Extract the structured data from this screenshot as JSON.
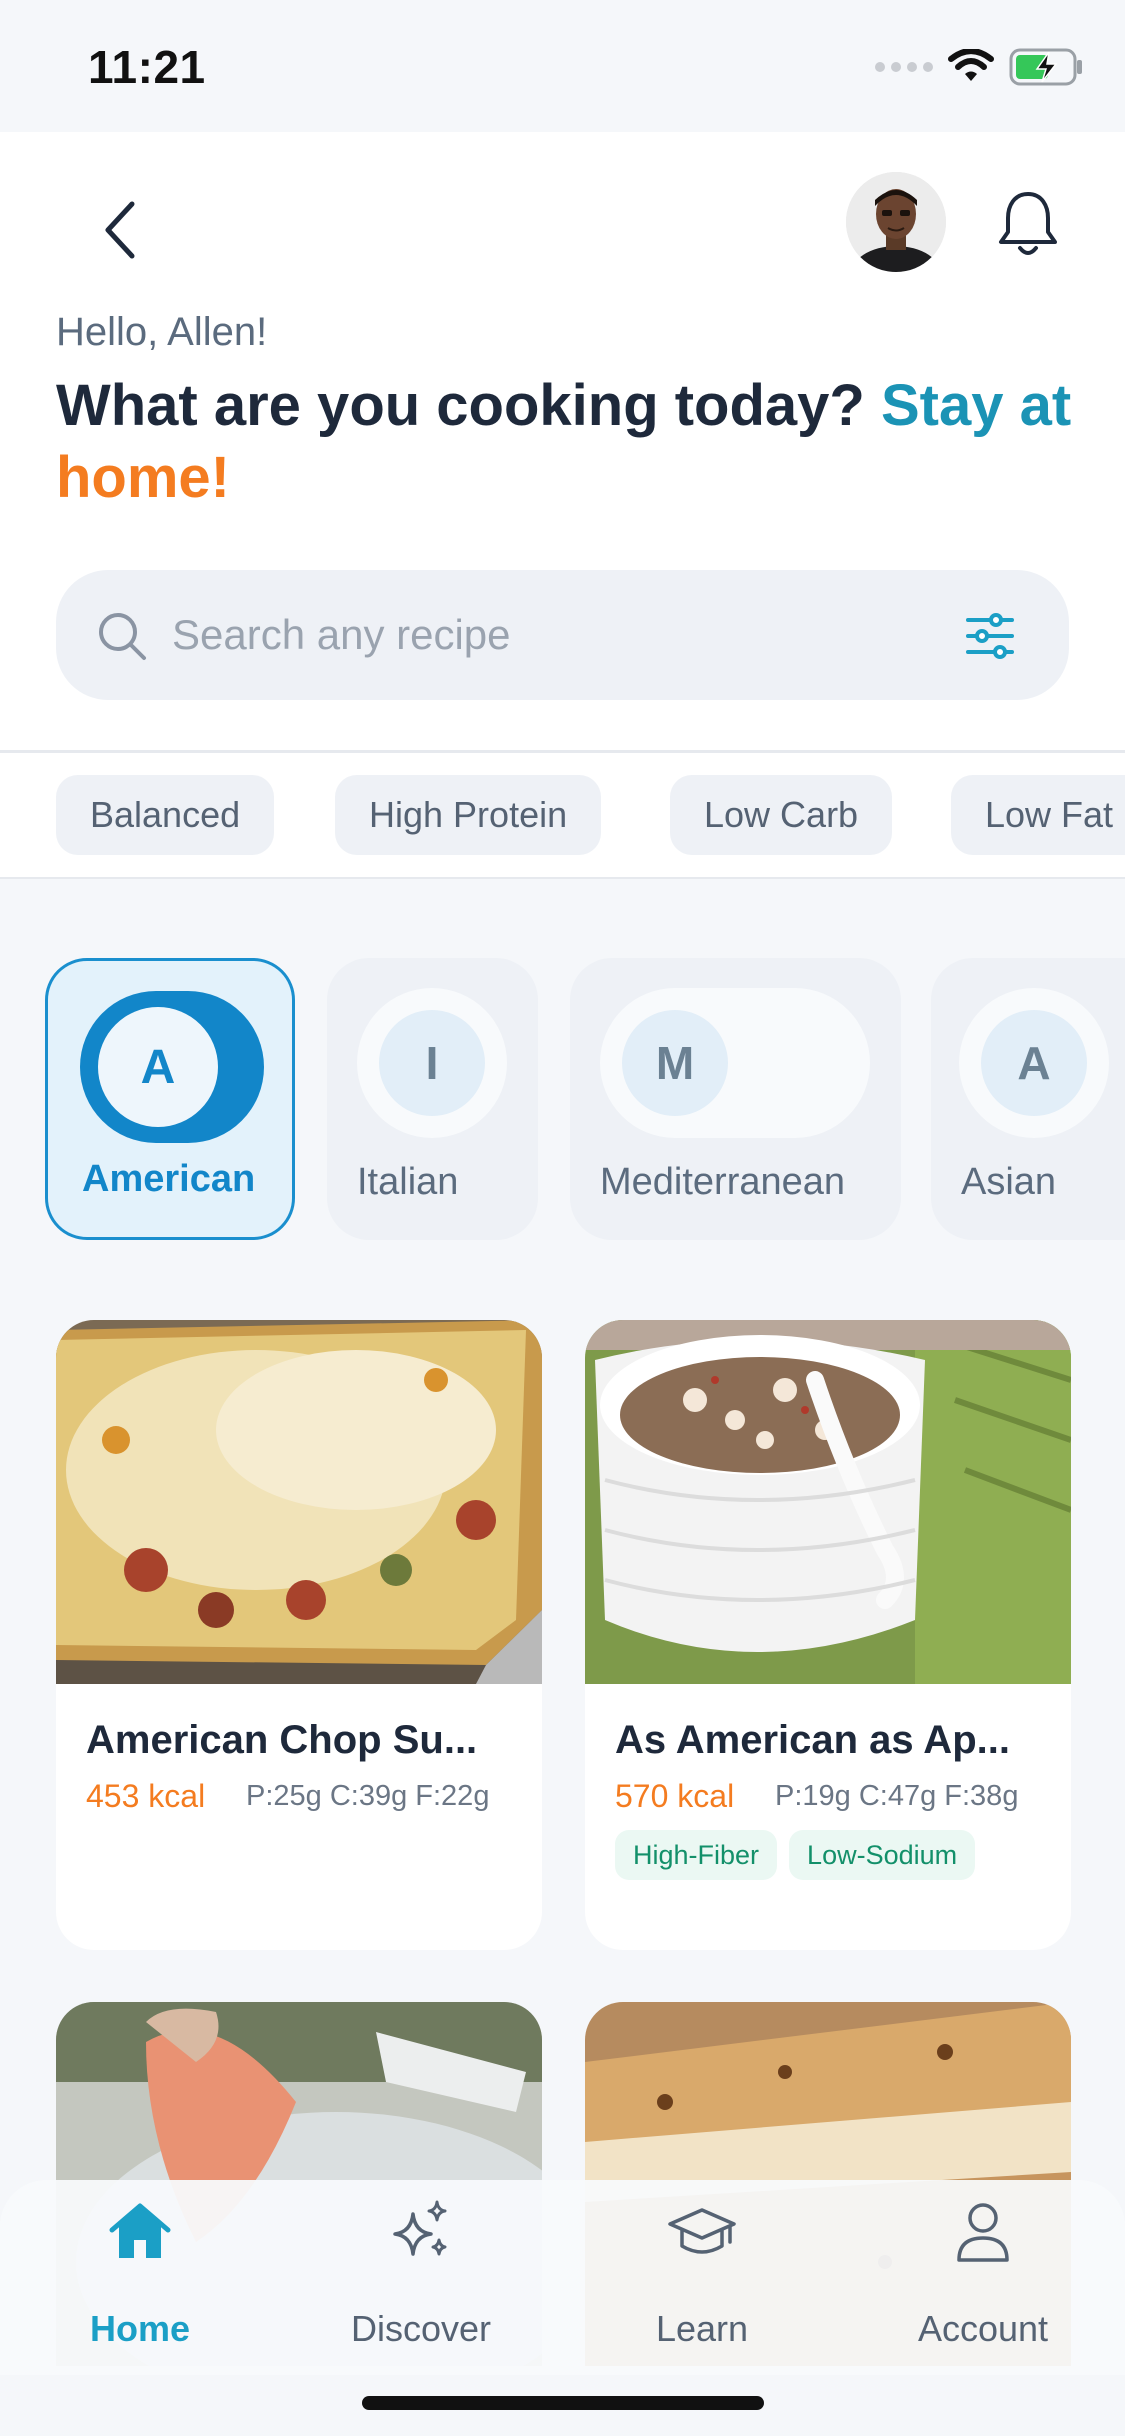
{
  "status_bar": {
    "time": "11:21"
  },
  "header": {
    "greeting": "Hello, Allen!",
    "headline": {
      "part1": "What are you cooking today? ",
      "part2": "Stay at ",
      "part3": "home!"
    },
    "search": {
      "placeholder": "Search any recipe"
    }
  },
  "diet_filters": [
    "Balanced",
    "High Protein",
    "Low Carb",
    "Low Fat"
  ],
  "cuisines": [
    {
      "initial": "A",
      "label": "American",
      "selected": true
    },
    {
      "initial": "I",
      "label": "Italian",
      "selected": false
    },
    {
      "initial": "M",
      "label": "Mediterranean",
      "selected": false
    },
    {
      "initial": "A",
      "label": "Asian",
      "selected": false
    }
  ],
  "recipes": [
    {
      "title": "American Chop Su...",
      "kcal": "453 kcal",
      "macros": "P:25g C:39g F:22g",
      "tags": []
    },
    {
      "title": "As American as Ap...",
      "kcal": "570 kcal",
      "macros": "P:19g C:47g F:38g",
      "tags": [
        "High-Fiber",
        "Low-Sodium"
      ]
    },
    {
      "title": "",
      "kcal": "",
      "macros": "",
      "tags": []
    },
    {
      "title": "",
      "kcal": "",
      "macros": "",
      "tags": []
    }
  ],
  "tabbar": {
    "tabs": [
      {
        "label": "Home",
        "icon": "home-icon",
        "active": true
      },
      {
        "label": "Discover",
        "icon": "sparkles-icon",
        "active": false
      },
      {
        "label": "Learn",
        "icon": "graduation-cap-icon",
        "active": false
      },
      {
        "label": "Account",
        "icon": "user-icon",
        "active": false
      }
    ]
  },
  "colors": {
    "accent_teal": "#1b93b5",
    "accent_orange": "#f47c20",
    "selected_blue": "#1286c9",
    "tag_green": "#13906a"
  }
}
